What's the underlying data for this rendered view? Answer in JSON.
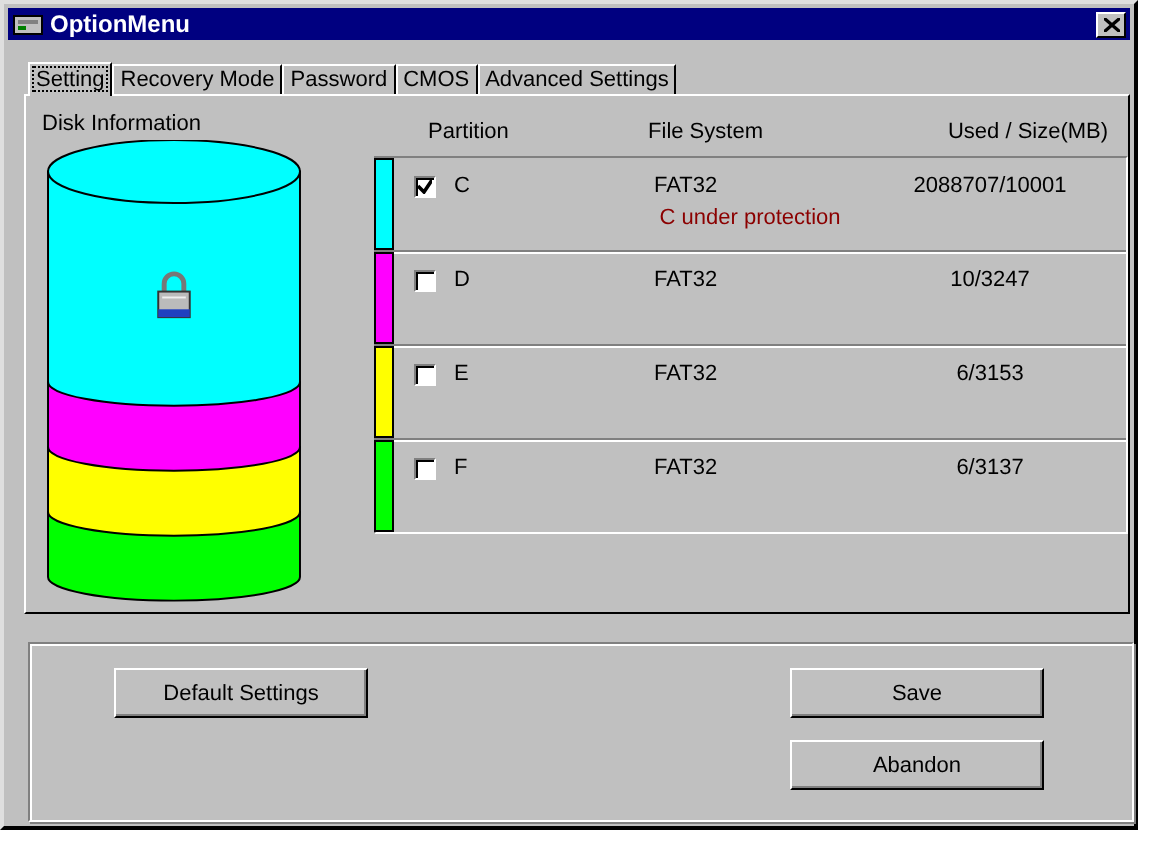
{
  "window": {
    "title": "OptionMenu"
  },
  "tabs": [
    {
      "label": "Setting",
      "selected": true
    },
    {
      "label": "Recovery Mode",
      "selected": false
    },
    {
      "label": "Password",
      "selected": false
    },
    {
      "label": "CMOS",
      "selected": false
    },
    {
      "label": "Advanced Settings",
      "selected": false
    }
  ],
  "disk_information": {
    "label": "Disk Information"
  },
  "table": {
    "columns": [
      "Partition",
      "File System",
      "Used / Size(MB)"
    ],
    "rows": [
      {
        "partition": "C",
        "file_system": "FAT32",
        "used_size": "2088707/10001",
        "checked": true,
        "color": "#00ffff",
        "note": "C under protection"
      },
      {
        "partition": "D",
        "file_system": "FAT32",
        "used_size": "10/3247",
        "checked": false,
        "color": "#ff00ff"
      },
      {
        "partition": "E",
        "file_system": "FAT32",
        "used_size": "6/3153",
        "checked": false,
        "color": "#ffff00"
      },
      {
        "partition": "F",
        "file_system": "FAT32",
        "used_size": "6/3137",
        "checked": false,
        "color": "#00ff00"
      }
    ]
  },
  "buttons": {
    "left": [
      "Default Settings"
    ],
    "right": [
      "Save",
      "Abandon"
    ]
  }
}
